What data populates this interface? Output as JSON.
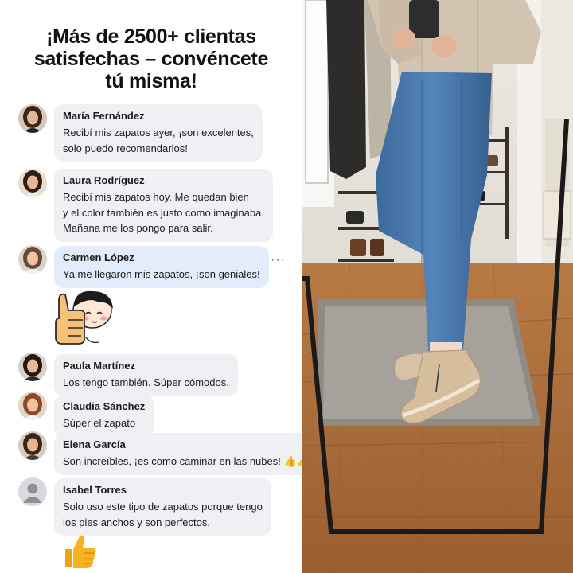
{
  "headline": {
    "line1": "¡Más de 2500+ clientas",
    "line2": "satisfechas – convéncete",
    "line3": "tú misma!"
  },
  "reviews": [
    {
      "name": "María Fernández",
      "lines": [
        "Recibí mis zapatos ayer, ¡son excelentes,",
        "solo puedo recomendarlos!"
      ]
    },
    {
      "name": "Laura Rodríguez",
      "lines": [
        "Recibí mis zapatos hoy. Me quedan bien",
        "y el color también es justo como imaginaba.",
        "Mañana me los pongo para salir."
      ]
    },
    {
      "name": "Carmen López",
      "lines": [
        "Ya me llegaron mis zapatos, ¡son geniales!"
      ]
    },
    {
      "name": "Paula Martínez",
      "lines": [
        "Los tengo también. Súper cómodos."
      ]
    },
    {
      "name": "Claudia Sánchez",
      "lines": [
        "Súper el zapato"
      ]
    },
    {
      "name": "Elena García",
      "lines": [
        "Son increíbles, ¡es como caminar en las nubes! 👍👍👍"
      ]
    },
    {
      "name": "Isabel Torres",
      "lines": [
        "Solo uso este tipo de zapatos porque tengo",
        "los pies anchos y son perfectos."
      ]
    }
  ],
  "more_options": "···",
  "colors": {
    "bubble": "#eff0f3",
    "bubble_highlight": "#e3ecfb",
    "thumb": "#f5b324"
  },
  "icons": [
    "thumbs-up-sticker",
    "thumbs-up-emoji",
    "default-avatar-icon",
    "more-options-icon"
  ]
}
